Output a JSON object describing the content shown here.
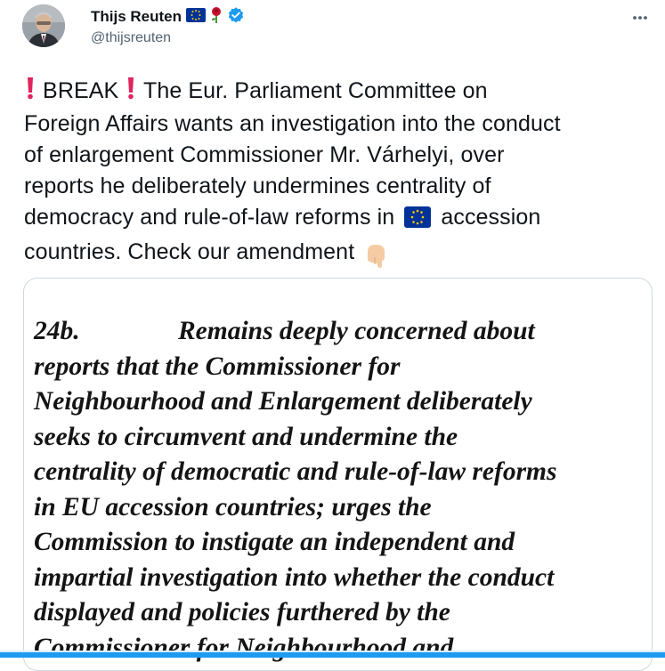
{
  "author": {
    "name": "Thijs Reuten",
    "handle": "@thijsreuten",
    "badges": [
      "eu-flag-icon",
      "rose-icon",
      "verified-icon"
    ],
    "verified_color": "#1d9bf0"
  },
  "tweet": {
    "lines": [
      "BREAK",
      "The Eur. Parliament Committee on",
      "Foreign Affairs wants an investigation into the conduct",
      "of enlargement Commissioner Mr.  Várhelyi, over",
      "reports he deliberately undermines centrality of",
      "democracy and rule-of-law reforms in",
      "accession",
      "countries. Check our amendment"
    ]
  },
  "media": {
    "number": "24b.",
    "lines": [
      "Remains deeply concerned about",
      "reports that the Commissioner for",
      "Neighbourhood and Enlargement deliberately",
      "seeks to circumvent and undermine the",
      "centrality of democratic and rule-of-law reforms",
      "in EU accession countries; urges the",
      "Commission to instigate an independent and",
      "impartial investigation into whether the conduct",
      "displayed and policies furthered by the",
      "Commissioner for Neighbourhood and"
    ]
  },
  "colors": {
    "text": "#0f1419",
    "secondary": "#536471",
    "accent": "#1d9bf0",
    "exclamation": "#e0245e"
  }
}
